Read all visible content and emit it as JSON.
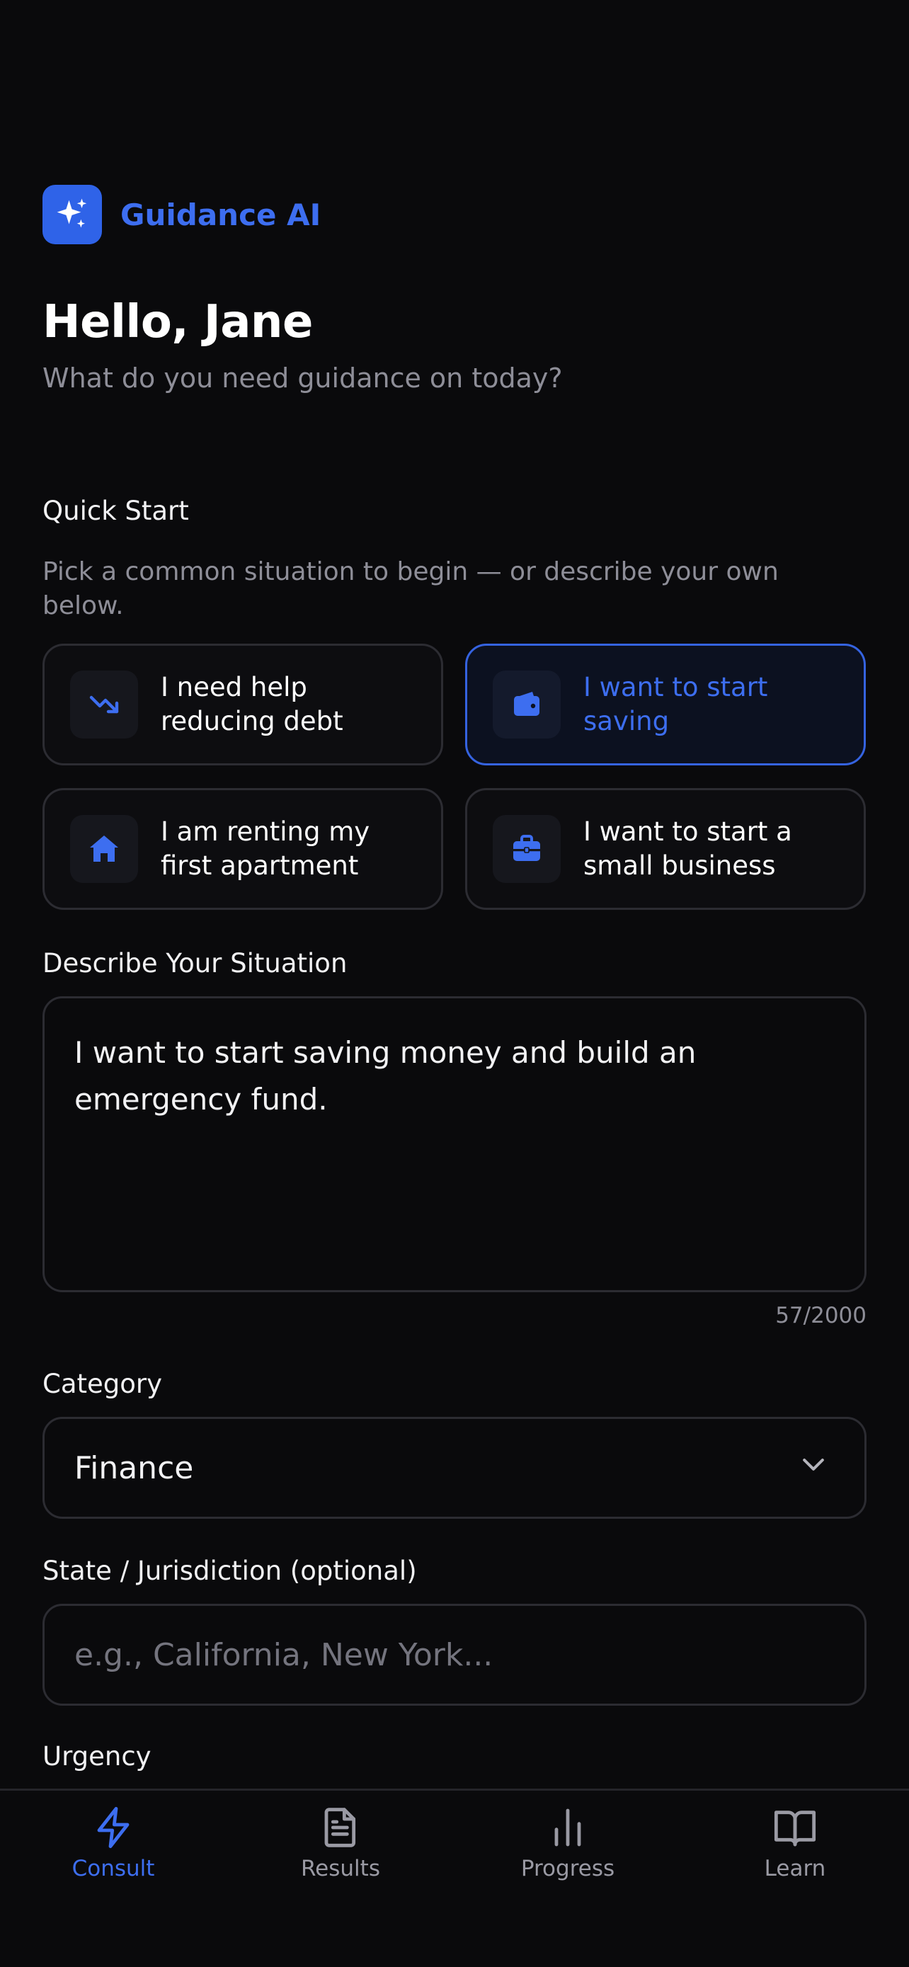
{
  "brand": {
    "name": "Guidance AI",
    "logo_icon": "sparkles-icon",
    "accent": "#2f63e8"
  },
  "greeting": {
    "title": "Hello, Jane",
    "subtitle": "What do you need guidance on today?"
  },
  "quick_start": {
    "label": "Quick Start",
    "help": "Pick a common situation to begin — or describe your own below.",
    "options": [
      {
        "label": "I need help reducing debt",
        "icon": "trending-down-icon",
        "selected": false
      },
      {
        "label": "I want to start saving",
        "icon": "wallet-icon",
        "selected": true
      },
      {
        "label": "I am renting my first apartment",
        "icon": "home-icon",
        "selected": false
      },
      {
        "label": "I want to start a small business",
        "icon": "briefcase-icon",
        "selected": false
      }
    ]
  },
  "situation": {
    "label": "Describe Your Situation",
    "value": "I want to start saving money and build an emergency fund.",
    "char_count": "57/2000"
  },
  "category": {
    "label": "Category",
    "value": "Finance"
  },
  "jurisdiction": {
    "label": "State / Jurisdiction (optional)",
    "placeholder": "e.g., California, New York..."
  },
  "urgency": {
    "label": "Urgency"
  },
  "nav": {
    "items": [
      {
        "label": "Consult",
        "icon": "lightning-icon",
        "active": true
      },
      {
        "label": "Results",
        "icon": "document-icon",
        "active": false
      },
      {
        "label": "Progress",
        "icon": "bar-chart-icon",
        "active": false
      },
      {
        "label": "Learn",
        "icon": "book-icon",
        "active": false
      }
    ]
  }
}
